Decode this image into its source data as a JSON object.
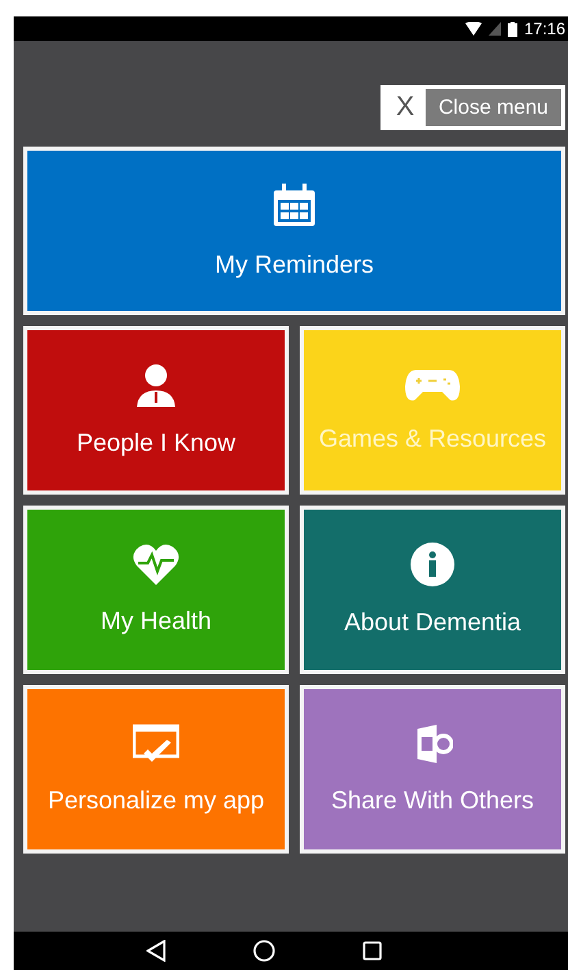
{
  "status_bar": {
    "time": "17:16"
  },
  "close_menu": {
    "icon_text": "X",
    "label": "Close menu"
  },
  "tiles": [
    {
      "label": "My Reminders",
      "color": "#0070c4",
      "wide": true
    },
    {
      "label": "People I Know",
      "color": "#c00d0d",
      "wide": false
    },
    {
      "label": "Games & Resources",
      "color": "#fbd41a",
      "wide": false
    },
    {
      "label": "My Health",
      "color": "#2fa30a",
      "wide": false
    },
    {
      "label": "About Dementia",
      "color": "#136e6a",
      "wide": false
    },
    {
      "label": "Personalize my app",
      "color": "#fd7300",
      "wide": false
    },
    {
      "label": "Share With Others",
      "color": "#9e73bd",
      "wide": false
    }
  ]
}
